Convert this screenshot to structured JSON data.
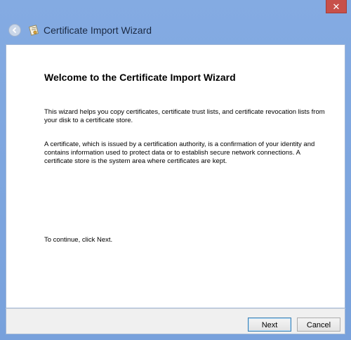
{
  "window": {
    "close_glyph": "✕",
    "title": "Certificate Import Wizard"
  },
  "page": {
    "heading": "Welcome to the Certificate Import Wizard",
    "paragraph1": "This wizard helps you copy certificates, certificate trust lists, and certificate revocation lists from your disk to a certificate store.",
    "paragraph2": "A certificate, which is issued by a certification authority, is a confirmation of your identity and contains information used to protect data or to establish secure network connections. A certificate store is the system area where certificates are kept.",
    "paragraph3": "To continue, click Next."
  },
  "buttons": {
    "next": "Next",
    "cancel": "Cancel"
  },
  "icons": {
    "back": "back-arrow-icon",
    "app": "certificate-icon",
    "close": "close-icon"
  },
  "colors": {
    "frame": "#7ea6de",
    "close": "#c7504a"
  }
}
